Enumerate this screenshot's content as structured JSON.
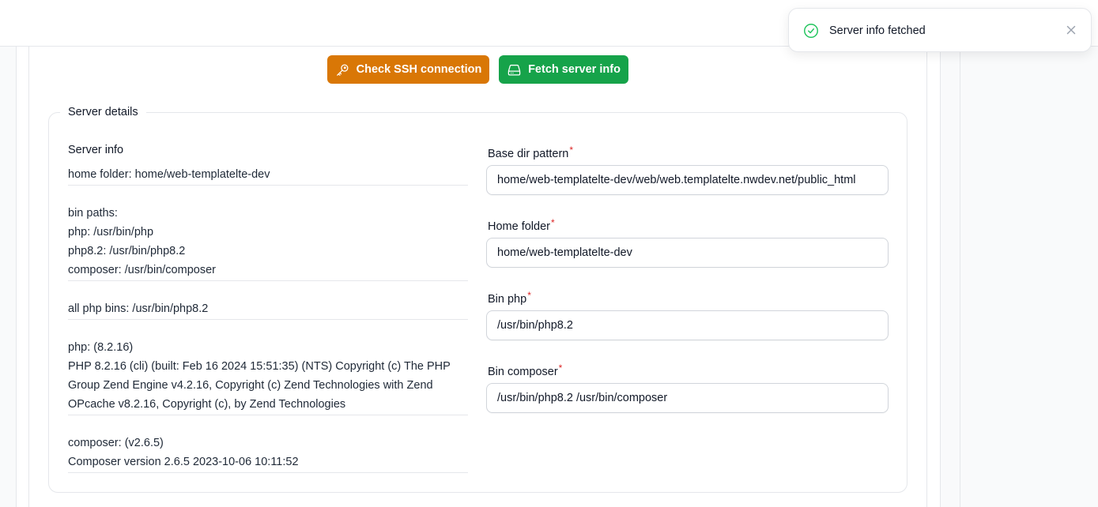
{
  "toolbar": {
    "check_ssh_label": "Check SSH connection",
    "check_ssh_icon": "key-icon",
    "check_ssh_color": "#d97706",
    "fetch_info_label": "Fetch server info",
    "fetch_info_icon": "server-icon",
    "fetch_info_color": "#16a34a"
  },
  "server_details": {
    "legend": "Server details",
    "info_title": "Server info",
    "info": {
      "home_folder": "home folder: home/web-templatelte-dev",
      "bin_paths_title": "bin paths:",
      "bin_paths": [
        "php: /usr/bin/php",
        "php8.2: /usr/bin/php8.2",
        "composer: /usr/bin/composer"
      ],
      "all_php_bins": "all php bins: /usr/bin/php8.2",
      "php_version": "php: (8.2.16)",
      "php_details": "PHP 8.2.16 (cli) (built: Feb 16 2024 15:51:35) (NTS) Copyright (c) The PHP Group Zend Engine v4.2.16, Copyright (c) Zend Technologies with Zend OPcache v8.2.16, Copyright (c), by Zend Technologies",
      "composer_version": "composer: (v2.6.5)",
      "composer_details": "Composer version 2.6.5 2023-10-06 10:11:52"
    },
    "form": {
      "base_dir_label": "Base dir pattern",
      "base_dir_value": "home/web-templatelte-dev/web/web.templatelte.nwdev.net/public_html",
      "home_folder_label": "Home folder",
      "home_folder_value": "home/web-templatelte-dev",
      "bin_php_label": "Bin php",
      "bin_php_value": "/usr/bin/php8.2",
      "bin_composer_label": "Bin composer",
      "bin_composer_value": "/usr/bin/php8.2 /usr/bin/composer",
      "required_mark": "*"
    }
  },
  "toast": {
    "message": "Server info fetched",
    "icon": "check-circle-icon",
    "close_icon": "close-icon",
    "color": "#22c55e"
  }
}
